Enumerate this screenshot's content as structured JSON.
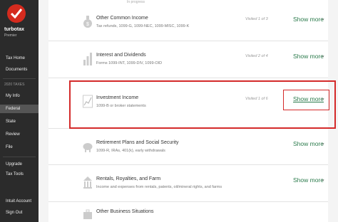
{
  "brand": {
    "name": "turbotax",
    "edition": "Premier"
  },
  "sidebar": {
    "items_top": [
      {
        "label": "Tax Home"
      },
      {
        "label": "Documents"
      }
    ],
    "section_label": "2020 TAXES",
    "items_mid": [
      {
        "label": "My Info"
      },
      {
        "label": "Federal"
      },
      {
        "label": "State"
      },
      {
        "label": "Review"
      },
      {
        "label": "File"
      }
    ],
    "items_low": [
      {
        "label": "Upgrade"
      },
      {
        "label": "Tax Tools"
      }
    ],
    "items_bottom": [
      {
        "label": "Intuit Account"
      },
      {
        "label": "Sign Out"
      }
    ]
  },
  "progress_label": "In progress",
  "rows": [
    {
      "title": "Other Common Income",
      "subtitle": "Tax refunds, 1099-G, 1099-NEC, 1099-MISC, 1099-K",
      "visited": "Visited 1 of 3",
      "action": "Show more"
    },
    {
      "title": "Interest and Dividends",
      "subtitle": "Forms 1099-INT, 1099-DIV, 1099-OID",
      "visited": "Visited 2 of 4",
      "action": "Show more"
    },
    {
      "title": "Investment Income",
      "subtitle": "1099-B or broker statements",
      "visited": "Visited 1 of 6",
      "action": "Show more"
    },
    {
      "title": "Retirement Plans and Social Security",
      "subtitle": "1099-R, IRAs, 401(k), early withdrawals",
      "visited": "",
      "action": "Show more"
    },
    {
      "title": "Rentals, Royalties, and Farm",
      "subtitle": "Income and expenses from rentals, patents, oil/mineral rights, and farms",
      "visited": "",
      "action": "Show more"
    },
    {
      "title": "Other Business Situations",
      "subtitle": "",
      "visited": "",
      "action": ""
    }
  ],
  "colors": {
    "accent_green": "#2a7a4b",
    "highlight_red": "#d42a2a",
    "brand_red": "#d52b1e"
  }
}
